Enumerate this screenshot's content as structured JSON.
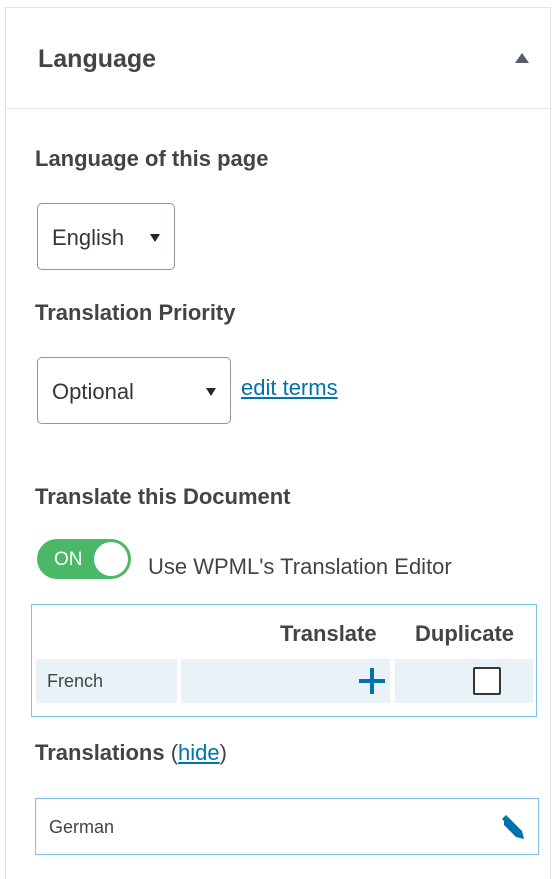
{
  "panel": {
    "title": "Language"
  },
  "language_of_page": {
    "label": "Language of this page",
    "selected": "English"
  },
  "translation_priority": {
    "label": "Translation Priority",
    "selected": "Optional",
    "edit_link": "edit terms"
  },
  "translate_document": {
    "label": "Translate this Document",
    "toggle_state": "ON",
    "toggle_label": "Use WPML's Translation Editor"
  },
  "table": {
    "headers": [
      "Translate",
      "Duplicate"
    ],
    "rows": [
      {
        "language": "French"
      }
    ]
  },
  "translations": {
    "label": "Translations",
    "open_paren": "(",
    "hide_link": "hide",
    "close_paren": ")",
    "items": [
      "German"
    ]
  },
  "colors": {
    "toggle_on": "#4ab866",
    "link": "#0073aa",
    "table_border": "#7cc3e5",
    "row_bg": "#e9f2f7"
  }
}
